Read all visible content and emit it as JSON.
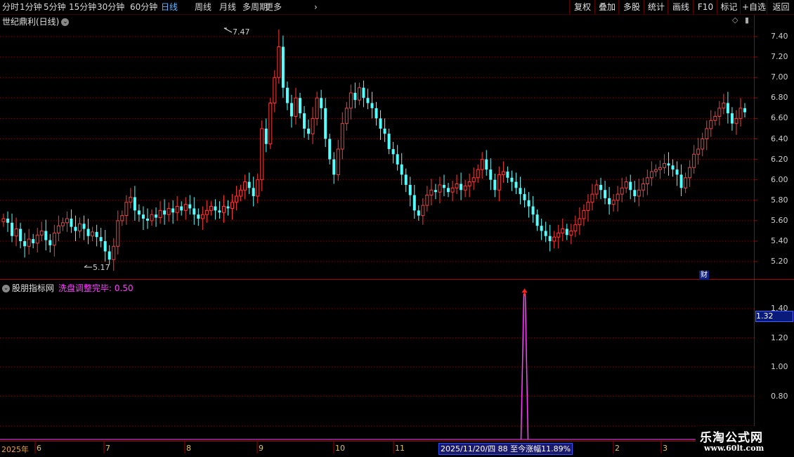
{
  "toolbar": {
    "periods": [
      "分时",
      "1分钟",
      "5分钟",
      "15分钟",
      "30分钟",
      "60分钟",
      "日线",
      "周线",
      "月线",
      "多周期",
      "更多"
    ],
    "active_period": "日线",
    "right_buttons": [
      "复权",
      "叠加",
      "多股",
      "统计",
      "画线",
      "F10",
      "标记",
      "+自选",
      "返回"
    ]
  },
  "main_chart": {
    "title": "世纪鼎利(日线)",
    "y_ticks": [
      "7.40",
      "7.20",
      "7.00",
      "6.80",
      "6.60",
      "6.40",
      "6.20",
      "6.00",
      "5.80",
      "5.60",
      "5.40",
      "5.20"
    ],
    "high_label": "7.47",
    "low_label": "5.17",
    "finance_badge": "财"
  },
  "sub_chart": {
    "title": "股朋指标网",
    "indicator_label": "洗盘调整完毕: 0.50",
    "y_ticks": [
      "1.40",
      "1.20",
      "1.00",
      "0.80"
    ],
    "cursor_value": "1.32"
  },
  "time_axis": {
    "labels": [
      "2025年",
      "6",
      "7",
      "8",
      "9",
      "10",
      "11",
      "2",
      "3"
    ],
    "tooltip": "2025/11/20/四 88 至今涨幅11.89%"
  },
  "watermark": {
    "title": "乐淘公式网",
    "url": "www.60lt.com"
  },
  "colors": {
    "up": "#ff3b3b",
    "down": "#54ffff",
    "indicator": "#ff40ff",
    "grid": "#8b0000"
  },
  "chart_data": {
    "type": "candlestick",
    "title": "世纪鼎利(日线)",
    "ylim": [
      5.1,
      7.55
    ],
    "high": 7.47,
    "low": 5.17,
    "signal": {
      "name": "洗盘调整完毕",
      "value": 1.5,
      "bar_index": 123
    },
    "closes": [
      5.62,
      5.58,
      5.45,
      5.52,
      5.4,
      5.35,
      5.42,
      5.38,
      5.46,
      5.5,
      5.41,
      5.36,
      5.48,
      5.55,
      5.58,
      5.62,
      5.54,
      5.5,
      5.57,
      5.52,
      5.45,
      5.49,
      5.44,
      5.4,
      5.3,
      5.22,
      5.35,
      5.6,
      5.65,
      5.78,
      5.83,
      5.7,
      5.66,
      5.62,
      5.6,
      5.66,
      5.63,
      5.7,
      5.66,
      5.72,
      5.68,
      5.74,
      5.7,
      5.76,
      5.72,
      5.66,
      5.62,
      5.66,
      5.7,
      5.74,
      5.7,
      5.68,
      5.74,
      5.72,
      5.78,
      5.84,
      5.9,
      5.98,
      5.92,
      5.84,
      6.0,
      6.5,
      6.35,
      6.75,
      7.0,
      7.3,
      6.9,
      6.75,
      6.62,
      6.8,
      6.65,
      6.5,
      6.45,
      6.6,
      6.8,
      6.7,
      6.4,
      6.2,
      6.05,
      6.3,
      6.55,
      6.7,
      6.85,
      6.78,
      6.9,
      6.8,
      6.75,
      6.7,
      6.6,
      6.5,
      6.45,
      6.3,
      6.25,
      6.15,
      6.05,
      5.95,
      5.85,
      5.7,
      5.65,
      5.75,
      5.85,
      5.9,
      5.88,
      5.95,
      5.92,
      5.88,
      5.92,
      5.96,
      5.9,
      5.94,
      5.98,
      6.02,
      6.1,
      6.2,
      6.1,
      6.0,
      5.9,
      6.05,
      6.08,
      6.02,
      5.98,
      5.92,
      5.86,
      5.8,
      5.74,
      5.66,
      5.55,
      5.5,
      5.45,
      5.4,
      5.44,
      5.48,
      5.52,
      5.46,
      5.5,
      5.56,
      5.62,
      5.7,
      5.78,
      5.86,
      5.95,
      5.9,
      5.82,
      5.76,
      5.8,
      5.86,
      5.92,
      5.98,
      5.9,
      5.84,
      5.9,
      5.96,
      6.02,
      6.08,
      6.1,
      6.12,
      6.16,
      6.14,
      6.1,
      6.05,
      5.92,
      6.02,
      6.12,
      6.25,
      6.3,
      6.4,
      6.5,
      6.58,
      6.62,
      6.7,
      6.75,
      6.65,
      6.55,
      6.6,
      6.7,
      6.66
    ]
  }
}
